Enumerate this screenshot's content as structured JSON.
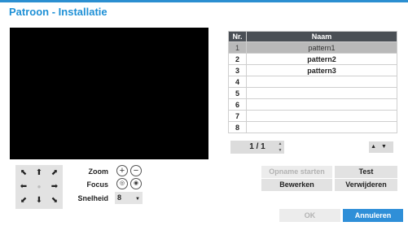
{
  "dialog": {
    "title": "Patroon - Installatie"
  },
  "table": {
    "headers": {
      "nr": "Nr.",
      "name": "Naam"
    },
    "rows": [
      {
        "nr": "1",
        "name": "pattern1"
      },
      {
        "nr": "2",
        "name": "pattern2"
      },
      {
        "nr": "3",
        "name": "pattern3"
      },
      {
        "nr": "4",
        "name": ""
      },
      {
        "nr": "5",
        "name": ""
      },
      {
        "nr": "6",
        "name": ""
      },
      {
        "nr": "7",
        "name": ""
      },
      {
        "nr": "8",
        "name": ""
      }
    ],
    "selected_row": 1
  },
  "pager": {
    "text": "1 / 1"
  },
  "controls": {
    "zoom_label": "Zoom",
    "focus_label": "Focus",
    "speed_label": "Snelheid",
    "speed_value": "8"
  },
  "buttons": {
    "record_start": "Opname starten",
    "test": "Test",
    "edit": "Bewerken",
    "delete": "Verwijderen",
    "ok": "OK",
    "cancel": "Annuleren"
  },
  "colors": {
    "accent": "#2f8fd8",
    "title": "#1e90d6",
    "header_bg": "#4a4f55"
  }
}
